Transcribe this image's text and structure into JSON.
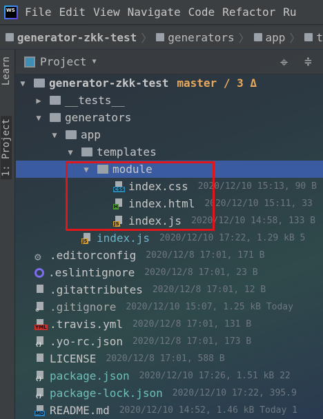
{
  "menu": [
    "File",
    "Edit",
    "View",
    "Navigate",
    "Code",
    "Refactor",
    "Ru"
  ],
  "breadcrumbs": [
    "generator-zkk-test",
    "generators",
    "app",
    "t"
  ],
  "side_tabs": {
    "learn": "Learn",
    "project": "1: Project"
  },
  "panel": {
    "title": "Project",
    "dropdown": "▼"
  },
  "colors": {
    "selection": "#3a5ba0",
    "highlight_box": "#e0161b",
    "branch": "#e8a95e"
  },
  "tree": [
    {
      "name": "generator-zkk-test",
      "level": 0,
      "type": "folder",
      "expanded": true,
      "bold": true,
      "branch": "master / 3 Δ"
    },
    {
      "name": "__tests__",
      "level": 1,
      "type": "folder",
      "expanded": false
    },
    {
      "name": "generators",
      "level": 1,
      "type": "folder",
      "expanded": true
    },
    {
      "name": "app",
      "level": 2,
      "type": "folder",
      "expanded": true
    },
    {
      "name": "templates",
      "level": 3,
      "type": "folder",
      "expanded": true
    },
    {
      "name": "module",
      "level": 4,
      "type": "folder",
      "expanded": true,
      "selected": true
    },
    {
      "name": "index.css",
      "level": 5,
      "type": "file",
      "badge": "CSS",
      "badgeColor": "#2a8bb8",
      "meta": "2020/12/10 15:13, 90 B",
      "color": "#c8c8c8"
    },
    {
      "name": "index.html",
      "level": 5,
      "type": "file",
      "badge": "H",
      "badgeColor": "#4a9e2c",
      "meta": "2020/12/10 15:11, 33",
      "color": "#c8c8c8"
    },
    {
      "name": "index.js",
      "level": 5,
      "type": "file",
      "badge": "JS",
      "badgeColor": "#d9a033",
      "meta": "2020/12/10 14:58, 133 B",
      "color": "#c8c8c8"
    },
    {
      "name": "index.js",
      "level": 3,
      "type": "file",
      "badge": "JS",
      "badgeColor": "#d9a033",
      "meta": "2020/12/10 17:22, 1.29 kB 5",
      "color": "#6fb3c8"
    },
    {
      "name": ".editorconfig",
      "level": 1,
      "type": "gear",
      "meta": "2020/12/8 17:01, 171 B",
      "color": "#c8c8c8"
    },
    {
      "name": ".eslintignore",
      "level": 1,
      "type": "ring",
      "meta": "2020/12/8 17:01, 23 B",
      "color": "#c8c8c8"
    },
    {
      "name": ".gitattributes",
      "level": 1,
      "type": "file",
      "meta": "2020/12/8 17:01, 12 B",
      "color": "#c8c8c8"
    },
    {
      "name": ".gitignore",
      "level": 1,
      "type": "file",
      "badge": "⊘",
      "badgeColor": "transparent",
      "meta": "2020/12/10 15:07, 1.25 kB Today",
      "color": "#a8a8a8"
    },
    {
      "name": ".travis.yml",
      "level": 1,
      "type": "file",
      "badge": "YML",
      "badgeColor": "#c8302b",
      "meta": "2020/12/8 17:01, 131 B",
      "color": "#c8c8c8"
    },
    {
      "name": ".yo-rc.json",
      "level": 1,
      "type": "file",
      "badge": "{}",
      "badgeColor": "transparent",
      "meta": "2020/12/8 17:01, 173 B",
      "color": "#c8c8c8"
    },
    {
      "name": "LICENSE",
      "level": 1,
      "type": "file",
      "meta": "2020/12/8 17:01, 588 B",
      "color": "#c8c8c8"
    },
    {
      "name": "package.json",
      "level": 1,
      "type": "file",
      "badge": "{}",
      "badgeColor": "transparent",
      "meta": "2020/12/10 17:26, 1.51 kB 22",
      "color": "#6fc0b8"
    },
    {
      "name": "package-lock.json",
      "level": 1,
      "type": "file",
      "badge": "{}",
      "badgeColor": "transparent",
      "meta": "2020/12/10 17:22, 395.9",
      "color": "#6fc0b8"
    },
    {
      "name": "README.md",
      "level": 1,
      "type": "file",
      "badge": "MD",
      "badgeColor": "#2a7fc0",
      "meta": "2020/12/10 14:52, 1.46 kB Today 1",
      "color": "#c8c8c8"
    }
  ]
}
